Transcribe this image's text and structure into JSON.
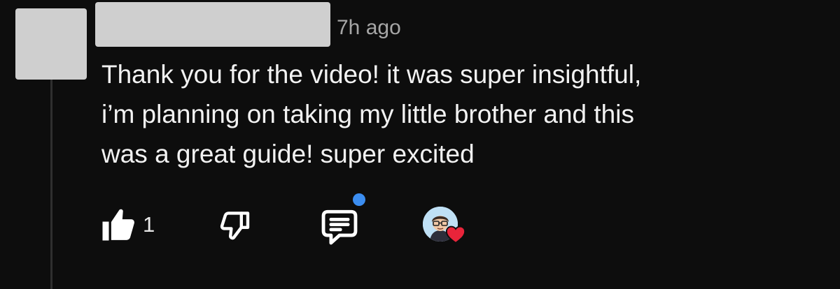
{
  "comment": {
    "timestamp": "7h ago",
    "lines": [
      "Thank you for the video! it was super insightful,",
      "i’m planning on taking my little brother and this",
      "was a great guide! super excited"
    ]
  },
  "actions": {
    "like_count": "1",
    "icons": [
      "thumbs-up-icon",
      "thumbs-down-icon",
      "reply-icon",
      "creator-heart-icon"
    ]
  },
  "colors": {
    "background": "#0d0d0d",
    "redaction": "#cfcfcf",
    "timestamp": "#a6a6a6",
    "notification_dot": "#3b8df0",
    "heart": "#e8243a"
  }
}
